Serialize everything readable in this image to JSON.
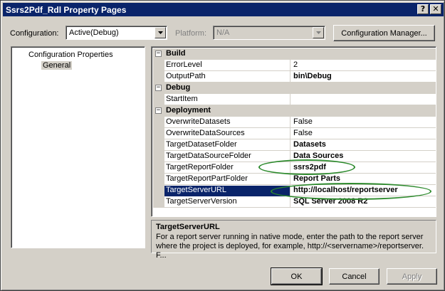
{
  "window": {
    "title": "Ssrs2Pdf_Rdl Property Pages",
    "help_glyph": "?",
    "close_glyph": "✕"
  },
  "toolbar": {
    "configuration_label": "Configuration:",
    "configuration_value": "Active(Debug)",
    "platform_label": "Platform:",
    "platform_value": "N/A",
    "config_manager_label": "Configuration Manager..."
  },
  "tree": {
    "root": "Configuration Properties",
    "child": "General"
  },
  "grid": {
    "categories": {
      "build": {
        "label": "Build",
        "toggle": "−"
      },
      "debug": {
        "label": "Debug",
        "toggle": "−"
      },
      "deployment": {
        "label": "Deployment",
        "toggle": "−"
      }
    },
    "build": [
      {
        "name": "ErrorLevel",
        "value": "2"
      },
      {
        "name": "OutputPath",
        "value": "bin\\Debug"
      }
    ],
    "debug": [
      {
        "name": "StartItem",
        "value": ""
      }
    ],
    "deployment": [
      {
        "name": "OverwriteDatasets",
        "value": "False"
      },
      {
        "name": "OverwriteDataSources",
        "value": "False"
      },
      {
        "name": "TargetDatasetFolder",
        "value": "Datasets"
      },
      {
        "name": "TargetDataSourceFolder",
        "value": "Data Sources"
      },
      {
        "name": "TargetReportFolder",
        "value": "ssrs2pdf"
      },
      {
        "name": "TargetReportPartFolder",
        "value": "Report Parts"
      },
      {
        "name": "TargetServerURL",
        "value": "http://localhost/reportserver"
      },
      {
        "name": "TargetServerVersion",
        "value": "SQL Server 2008 R2"
      }
    ]
  },
  "description": {
    "title": "TargetServerURL",
    "text": "For a report server running in native mode, enter the path to the report server where the project is deployed, for example, http://<servername>/reportserver. F..."
  },
  "buttons": {
    "ok": "OK",
    "cancel": "Cancel",
    "apply": "Apply"
  },
  "colors": {
    "selection": "#0a246a",
    "annotation": "#2e8b2e",
    "face": "#d4d0c8"
  }
}
